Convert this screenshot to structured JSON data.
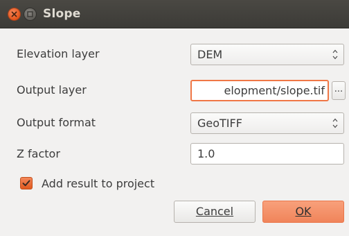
{
  "window": {
    "title": "Slope"
  },
  "form": {
    "elevation_label": "Elevation layer",
    "elevation_value": "DEM",
    "output_label": "Output layer",
    "output_value": "elopment/slope.tif",
    "browse_label": "...",
    "format_label": "Output format",
    "format_value": "GeoTIFF",
    "zfactor_label": "Z factor",
    "zfactor_value": "1.0",
    "add_result_label": "Add result to project",
    "add_result_checked": true
  },
  "buttons": {
    "cancel_label": "Cancel",
    "ok_label": "OK"
  },
  "colors": {
    "accent": "#f0845a",
    "titlebar": "#3c3b37",
    "background": "#f2f1f0"
  },
  "icons": {
    "close": "close-icon",
    "minimize": "minimize-icon",
    "spin": "spin-arrows-icon",
    "check": "check-icon"
  }
}
